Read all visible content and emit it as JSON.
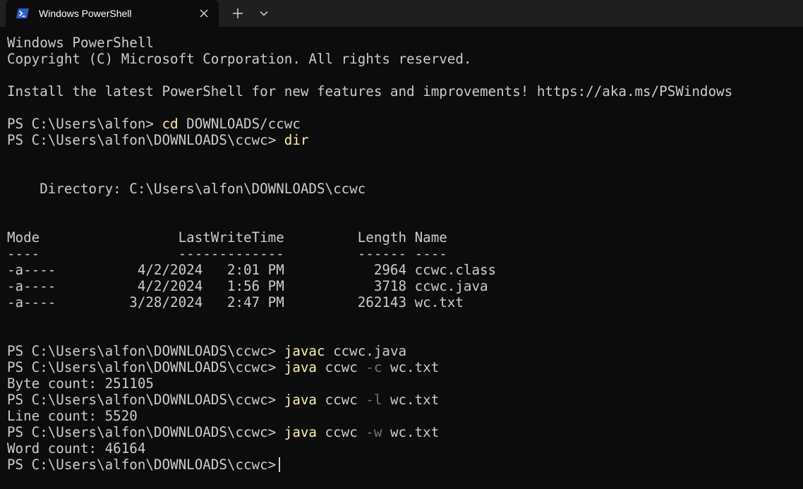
{
  "window": {
    "tab_title": "Windows PowerShell"
  },
  "console": {
    "lines": [
      [
        {
          "t": "Windows PowerShell",
          "c": "text"
        }
      ],
      [
        {
          "t": "Copyright (C) Microsoft Corporation. All rights reserved.",
          "c": "text"
        }
      ],
      [],
      [
        {
          "t": "Install the latest PowerShell for new features and improvements! https://aka.ms/PSWindows",
          "c": "text"
        }
      ],
      [],
      [
        {
          "t": "PS C:\\Users\\alfon> ",
          "c": "text"
        },
        {
          "t": "cd",
          "c": "cmd"
        },
        {
          "t": " DOWNLOADS/ccwc",
          "c": "text"
        }
      ],
      [
        {
          "t": "PS C:\\Users\\alfon\\DOWNLOADS\\ccwc> ",
          "c": "text"
        },
        {
          "t": "dir",
          "c": "cmd"
        }
      ],
      [],
      [],
      [
        {
          "t": "    Directory: C:\\Users\\alfon\\DOWNLOADS\\ccwc",
          "c": "text"
        }
      ],
      [],
      [],
      [
        {
          "t": "Mode                 LastWriteTime         Length Name",
          "c": "text"
        }
      ],
      [
        {
          "t": "----                 -------------         ------ ----",
          "c": "text"
        }
      ],
      [
        {
          "t": "-a----          4/2/2024   2:01 PM           2964 ccwc.class",
          "c": "text"
        }
      ],
      [
        {
          "t": "-a----          4/2/2024   1:56 PM           3718 ccwc.java",
          "c": "text"
        }
      ],
      [
        {
          "t": "-a----         3/28/2024   2:47 PM         262143 wc.txt",
          "c": "text"
        }
      ],
      [],
      [],
      [
        {
          "t": "PS C:\\Users\\alfon\\DOWNLOADS\\ccwc> ",
          "c": "text"
        },
        {
          "t": "javac",
          "c": "cmd"
        },
        {
          "t": " ccwc.java",
          "c": "text"
        }
      ],
      [
        {
          "t": "PS C:\\Users\\alfon\\DOWNLOADS\\ccwc> ",
          "c": "text"
        },
        {
          "t": "java",
          "c": "cmd"
        },
        {
          "t": " ccwc ",
          "c": "text"
        },
        {
          "t": "-c",
          "c": "param"
        },
        {
          "t": " wc.txt",
          "c": "text"
        }
      ],
      [
        {
          "t": "Byte count: 251105",
          "c": "text"
        }
      ],
      [
        {
          "t": "PS C:\\Users\\alfon\\DOWNLOADS\\ccwc> ",
          "c": "text"
        },
        {
          "t": "java",
          "c": "cmd"
        },
        {
          "t": " ccwc ",
          "c": "text"
        },
        {
          "t": "-l",
          "c": "param"
        },
        {
          "t": " wc.txt",
          "c": "text"
        }
      ],
      [
        {
          "t": "Line count: 5520",
          "c": "text"
        }
      ],
      [
        {
          "t": "PS C:\\Users\\alfon\\DOWNLOADS\\ccwc> ",
          "c": "text"
        },
        {
          "t": "java",
          "c": "cmd"
        },
        {
          "t": " ccwc ",
          "c": "text"
        },
        {
          "t": "-w",
          "c": "param"
        },
        {
          "t": " wc.txt",
          "c": "text"
        }
      ],
      [
        {
          "t": "Word count: 46164",
          "c": "text"
        }
      ],
      [
        {
          "t": "PS C:\\Users\\alfon\\DOWNLOADS\\ccwc>",
          "c": "text"
        }
      ]
    ]
  },
  "icons": {
    "tab_icon": "powershell-icon",
    "close": "close-icon",
    "new_tab": "plus-icon",
    "dropdown": "chevron-down-icon"
  },
  "colors": {
    "background": "#0c0c0c",
    "titlebar": "#1f1f1f",
    "text": "#cccccc",
    "command": "#f9f1a5",
    "parameter": "#767676",
    "powershell_blue": "#2f5ecf"
  }
}
